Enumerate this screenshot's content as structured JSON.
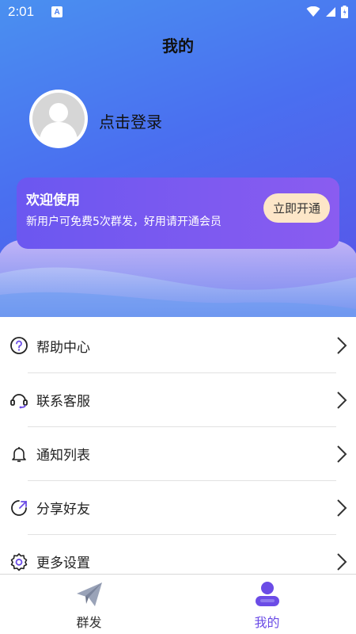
{
  "status_bar": {
    "time": "2:01",
    "notification_badge": "A"
  },
  "header": {
    "title": "我的"
  },
  "profile": {
    "login_text": "点击登录"
  },
  "vip_card": {
    "title": "欢迎使用",
    "description": "新用户可免费5次群发，好用请开通会员",
    "button_label": "立即开通"
  },
  "menu": {
    "items": [
      {
        "label": "帮助中心",
        "icon": "help-circle-icon"
      },
      {
        "label": "联系客服",
        "icon": "headset-icon"
      },
      {
        "label": "通知列表",
        "icon": "bell-icon"
      },
      {
        "label": "分享好友",
        "icon": "share-icon"
      },
      {
        "label": "更多设置",
        "icon": "gear-icon"
      }
    ]
  },
  "tab_bar": {
    "tabs": [
      {
        "label": "群发",
        "icon": "paper-plane-icon",
        "active": false
      },
      {
        "label": "我的",
        "icon": "user-icon",
        "active": true
      }
    ]
  },
  "colors": {
    "accent": "#6b4ce6",
    "inactive_tab": "#333333",
    "vip_button_bg": "#fde6c8"
  }
}
